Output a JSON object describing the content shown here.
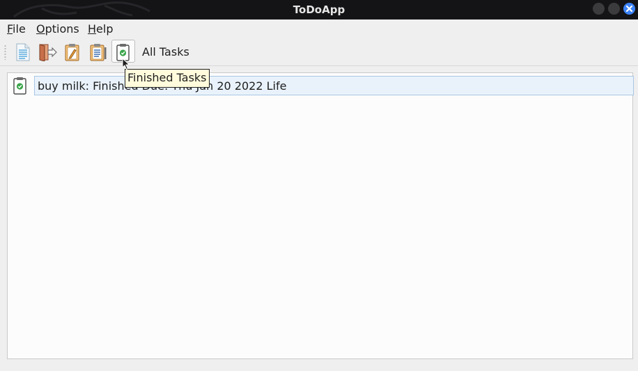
{
  "window": {
    "title": "ToDoApp"
  },
  "menubar": {
    "items": [
      {
        "accel": "F",
        "rest": "ile"
      },
      {
        "accel": "O",
        "rest": "ptions"
      },
      {
        "accel": "H",
        "rest": "elp"
      }
    ]
  },
  "toolbar": {
    "buttons": [
      {
        "icon": "new-document-icon"
      },
      {
        "icon": "exit-door-icon"
      },
      {
        "icon": "edit-clipboard-icon"
      },
      {
        "icon": "all-tasks-clipboard-icon"
      },
      {
        "icon": "finished-tasks-clipboard-icon",
        "hovered": true
      }
    ],
    "view_label": "All Tasks"
  },
  "tooltip": {
    "text": "Finished Tasks"
  },
  "task_list": {
    "items": [
      {
        "text": "buy milk: Finished Due: Thu Jan 20 2022 Life",
        "icon": "finished-task-icon",
        "selected": true
      }
    ]
  },
  "colors": {
    "accent_check": "#3aa54a",
    "selection_bg": "#e9f2fb",
    "close_button": "#3b82f6"
  }
}
